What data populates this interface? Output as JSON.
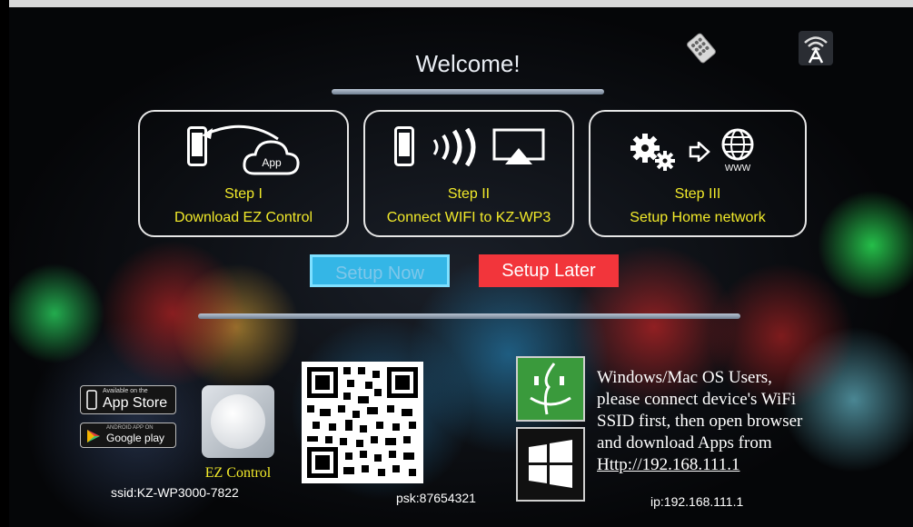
{
  "header": {
    "title": "Welcome!",
    "icons": [
      "remote-control-icon",
      "wifi-auto-icon"
    ]
  },
  "steps": [
    {
      "title": "Step I",
      "desc": "Download EZ Control",
      "icons": [
        "phone-icon",
        "app-cloud-icon"
      ],
      "cloud_label": "App"
    },
    {
      "title": "Step II",
      "desc": "Connect WIFI to KZ-WP3",
      "icons": [
        "phone-icon",
        "wifi-waves-icon",
        "airplay-icon"
      ]
    },
    {
      "title": "Step III",
      "desc": "Setup Home network",
      "icons": [
        "gears-icon",
        "arrow-right-icon",
        "globe-icon"
      ],
      "globe_label": "WWW"
    }
  ],
  "buttons": {
    "setup_now": "Setup Now",
    "setup_later": "Setup Later"
  },
  "footer": {
    "appstore_small": "Available on the",
    "appstore_large": "App Store",
    "googleplay_small": "ANDROID APP ON",
    "googleplay_large": "Google play",
    "ez_label": "EZ Control",
    "ssid": "ssid:KZ-WP3000-7822",
    "psk": "psk:87654321",
    "instruction_lines": [
      "Windows/Mac OS Users,",
      "please connect device's WiFi",
      "SSID first, then open browser",
      "and download Apps from"
    ],
    "link": "Http://192.168.111.1",
    "ip": "ip:192.168.111.1"
  },
  "colors": {
    "step_text": "#f2ea2a",
    "setup_now_bg": "#34b6e6",
    "setup_later_bg": "#f2353b",
    "accent_bar": "#9aa8b8"
  }
}
